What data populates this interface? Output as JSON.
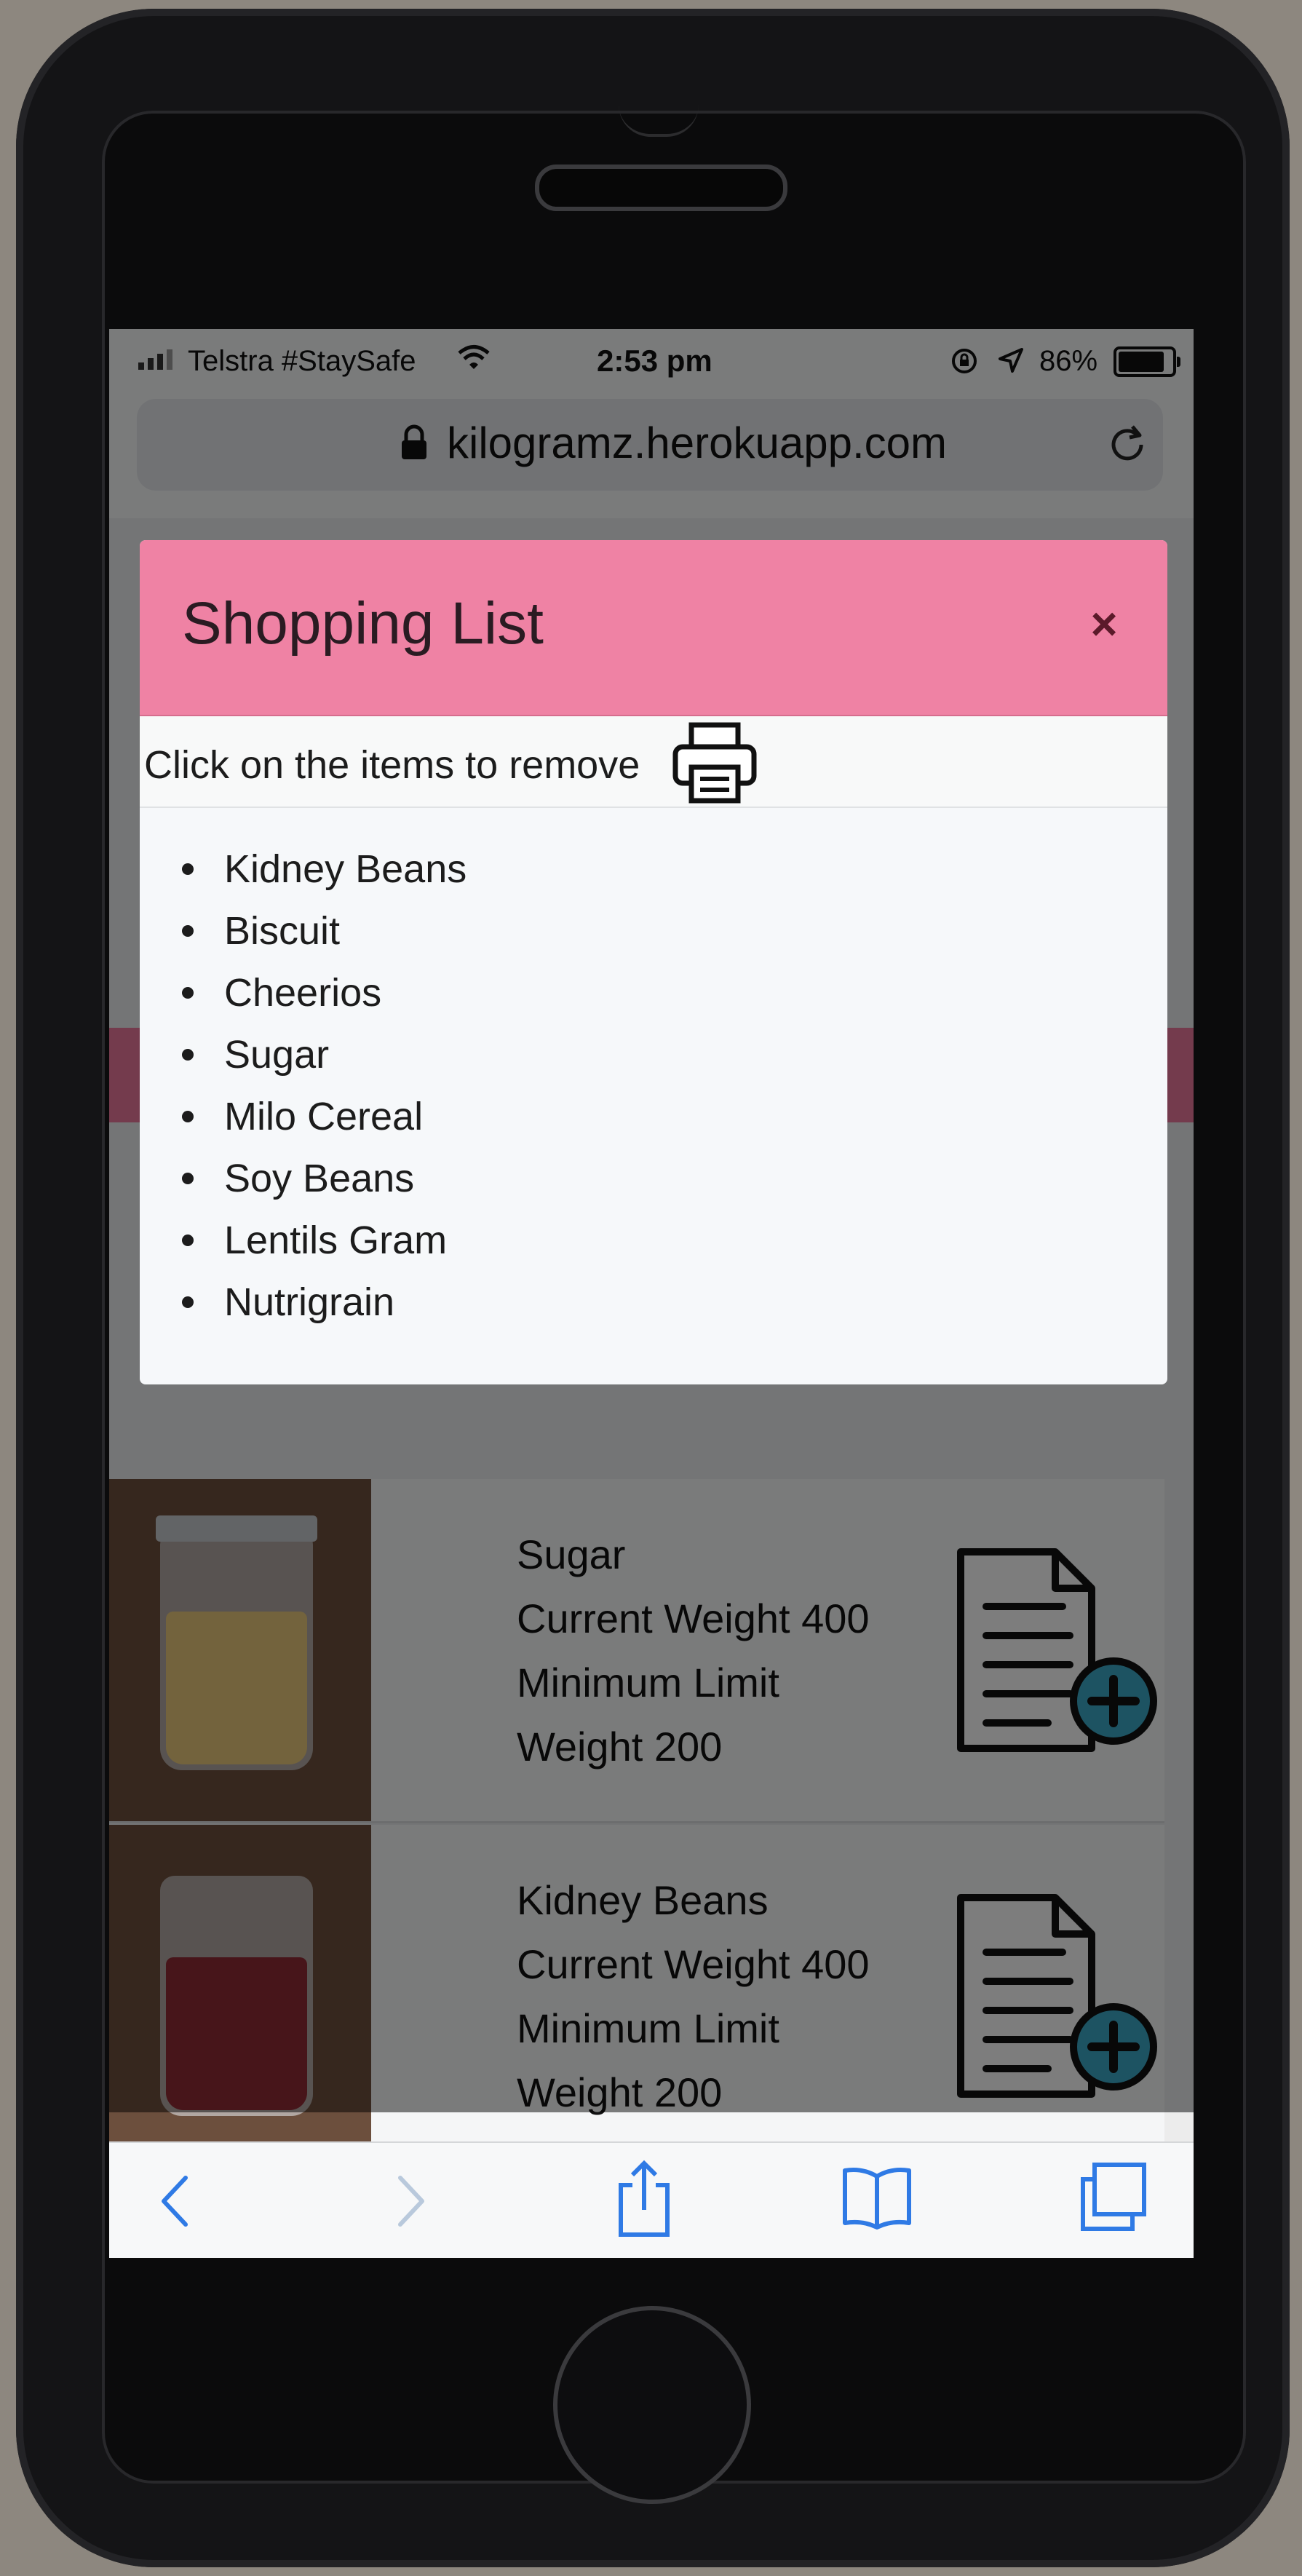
{
  "status_bar": {
    "carrier": "Telstra #StaySafe",
    "time": "2:53 pm",
    "battery_percent": "86%",
    "battery_level": 0.86
  },
  "browser": {
    "url": "kilogramz.herokuapp.com"
  },
  "modal": {
    "title": "Shopping List",
    "close_label": "×",
    "instructions": "Click on the items to remove",
    "items": [
      "Kidney Beans",
      "Biscuit",
      "Cheerios",
      "Sugar",
      "Milo Cereal",
      "Soy Beans",
      "Lentils Gram",
      "Nutrigrain"
    ]
  },
  "inventory": [
    {
      "name": "Sugar",
      "current_weight": "Current Weight 400",
      "minimum_limit": "Minimum Limit",
      "weight": "Weight 200",
      "contents_color": "#e6c67a"
    },
    {
      "name": "Kidney Beans",
      "current_weight": "Current Weight 400",
      "minimum_limit": "Minimum Limit",
      "weight": "Weight 200",
      "contents_color": "#8e2a35"
    }
  ],
  "colors": {
    "modal_header": "#ef82a4",
    "accent_teal": "#3aa6c4",
    "safari_blue": "#2f7ae5"
  }
}
